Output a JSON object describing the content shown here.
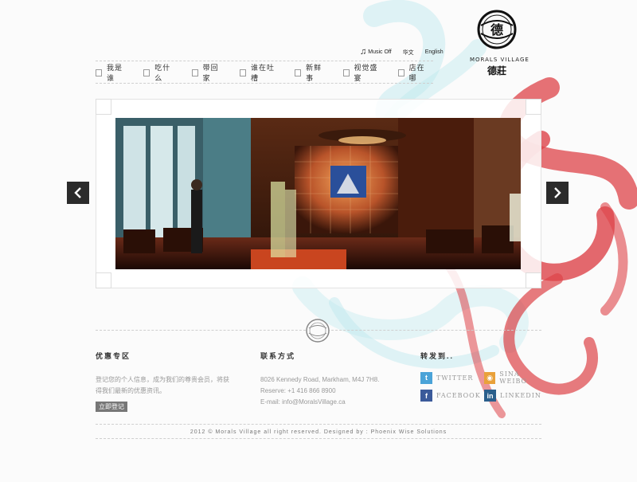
{
  "brand": {
    "name_en": "MORALS VILLAGE",
    "name_cn": "德莊",
    "seal_char": "德"
  },
  "topbar": {
    "music_label": "Music Off",
    "lang_cn": "华文",
    "lang_en": "English"
  },
  "nav": {
    "items": [
      {
        "label": "我是谁"
      },
      {
        "label": "吃什么"
      },
      {
        "label": "带回家"
      },
      {
        "label": "谁在吐槽"
      },
      {
        "label": "新鲜事"
      },
      {
        "label": "视觉盛宴"
      },
      {
        "label": "店在哪"
      }
    ]
  },
  "slider": {
    "prev_icon": "chevron-left-icon",
    "next_icon": "chevron-right-icon"
  },
  "footer": {
    "promo": {
      "title": "优惠专区",
      "text": "登记您的个人信息，成为我们的尊贵会员，将获得我们最新的优惠资讯。",
      "button": "立即登记"
    },
    "contact": {
      "title": "联系方式",
      "address": "8026 Kennedy Road, Markham, M4J 7H8.",
      "reserve": "Reserve: +1 416 866 8900",
      "email": "E-mail: info@MoralsVillage.ca"
    },
    "share": {
      "title": "转发到..",
      "items": [
        {
          "label": "TWITTER",
          "icon": "twitter-icon",
          "color": "#4aa3d8"
        },
        {
          "label": "SINA WEIBO",
          "icon": "weibo-icon",
          "color": "#e9a13a"
        },
        {
          "label": "FACEBOOK",
          "icon": "facebook-icon",
          "color": "#3b5a9a"
        },
        {
          "label": "LINKEDIN",
          "icon": "linkedin-icon",
          "color": "#2b5f8c"
        }
      ]
    },
    "copyright": "2012 © Morals Village all right reserved.  Designed by : Phoenix Wise Solutions"
  },
  "colors": {
    "accent_red": "#d8232a",
    "accent_cyan": "#7fd3df",
    "ink": "#222222"
  }
}
